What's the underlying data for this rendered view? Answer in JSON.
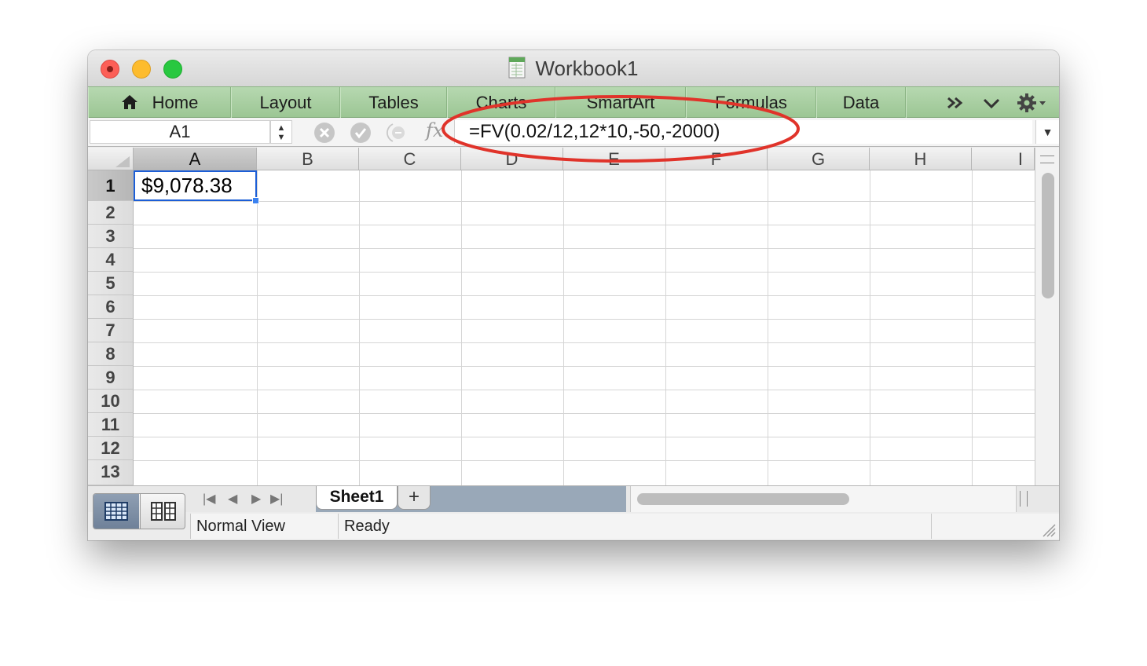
{
  "window": {
    "title": "Workbook1"
  },
  "ribbon": {
    "tabs": [
      {
        "label": "Home",
        "icon": "home-icon"
      },
      {
        "label": "Layout"
      },
      {
        "label": "Tables"
      },
      {
        "label": "Charts"
      },
      {
        "label": "SmartArt"
      },
      {
        "label": "Formulas"
      },
      {
        "label": "Data"
      }
    ],
    "more_icon": "chevrons-right-icon",
    "collapse_icon": "chevron-down-icon",
    "settings_icon": "gear-icon"
  },
  "formula_bar": {
    "name_box": "A1",
    "fx_label": "fx",
    "formula": "=FV(0.02/12,12*10,-50,-2000)"
  },
  "grid": {
    "columns": [
      "A",
      "B",
      "C",
      "D",
      "E",
      "F",
      "G",
      "H",
      "I"
    ],
    "rows": [
      "1",
      "2",
      "3",
      "4",
      "5",
      "6",
      "7",
      "8",
      "9",
      "10",
      "11",
      "12",
      "13"
    ],
    "active_cell": {
      "ref": "A1",
      "value": "$9,078.38"
    }
  },
  "sheets": {
    "tabs": [
      "Sheet1"
    ],
    "add_label": "+"
  },
  "status": {
    "view": "Normal View",
    "state": "Ready"
  },
  "colors": {
    "ribbon": "#9cc694",
    "selection": "#1c5ed6",
    "annotation": "#e0332a"
  }
}
